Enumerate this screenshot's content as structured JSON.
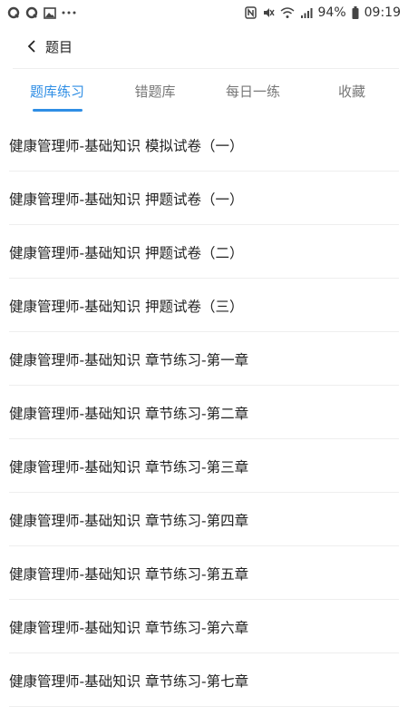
{
  "status_bar": {
    "battery": "94%",
    "time": "09:19",
    "left_icons": [
      "notification-q-icon",
      "notification-q-icon",
      "image-icon",
      "more-dots-icon"
    ],
    "right_icons": [
      "nfc-icon",
      "mute-icon",
      "wifi-icon",
      "signal-icon",
      "battery-icon"
    ]
  },
  "header": {
    "title": "题目"
  },
  "tabs": [
    {
      "label": "题库练习",
      "active": true
    },
    {
      "label": "错题库",
      "active": false
    },
    {
      "label": "每日一练",
      "active": false
    },
    {
      "label": "收藏",
      "active": false
    }
  ],
  "list": [
    {
      "label": "健康管理师-基础知识 模拟试卷（一）"
    },
    {
      "label": "健康管理师-基础知识 押题试卷（一）"
    },
    {
      "label": "健康管理师-基础知识 押题试卷（二）"
    },
    {
      "label": "健康管理师-基础知识 押题试卷（三）"
    },
    {
      "label": "健康管理师-基础知识 章节练习-第一章"
    },
    {
      "label": "健康管理师-基础知识 章节练习-第二章"
    },
    {
      "label": "健康管理师-基础知识 章节练习-第三章"
    },
    {
      "label": "健康管理师-基础知识 章节练习-第四章"
    },
    {
      "label": "健康管理师-基础知识 章节练习-第五章"
    },
    {
      "label": "健康管理师-基础知识 章节练习-第六章"
    },
    {
      "label": "健康管理师-基础知识 章节练习-第七章"
    }
  ],
  "colors": {
    "accent": "#2f8ee5",
    "text": "#222222",
    "muted": "#777777",
    "divider": "#eeeeee"
  }
}
